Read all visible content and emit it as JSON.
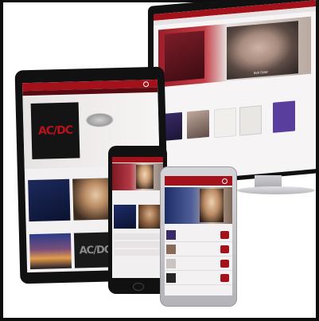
{
  "devices": {
    "monitor": {
      "brand": "",
      "hero_album": "Bob Dylan",
      "section_title": "",
      "albums": [
        "",
        "",
        "",
        "",
        ""
      ]
    },
    "tablet": {
      "brand": "",
      "featured_title": "AC/DC",
      "featured_caption": "",
      "section_one": "",
      "section_two": "",
      "tile_logo": "AC/DC"
    },
    "phone": {
      "brand": "",
      "section_label": ""
    },
    "android": {
      "brand": "",
      "list_rows": [
        "",
        "",
        "",
        ""
      ]
    }
  },
  "colors": {
    "brand_red": "#a3121b",
    "device_black": "#111111",
    "monitor_silver": "#d8d8dc",
    "purple_cover": "#5a3e9e"
  }
}
